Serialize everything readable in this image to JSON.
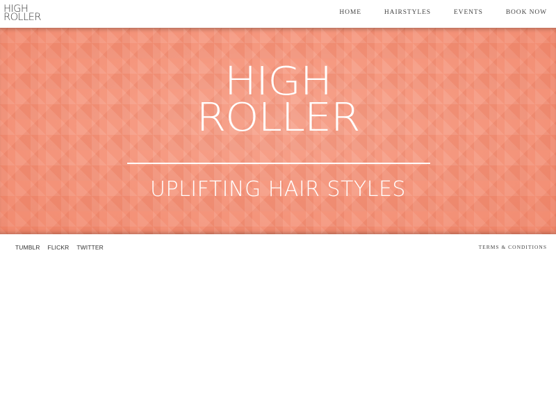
{
  "brand": {
    "logo_line1": "HIGH",
    "logo_line2": "ROLLER"
  },
  "nav": {
    "items": [
      {
        "label": "HOME"
      },
      {
        "label": "HAIRSTYLES"
      },
      {
        "label": "EVENTS"
      },
      {
        "label": "BOOK NOW"
      }
    ]
  },
  "hero": {
    "title_line1": "HIGH",
    "title_line2": "ROLLER",
    "tagline": "UPLIFTING HAIR STYLES",
    "background_color": "#f48c70"
  },
  "footer": {
    "social": [
      {
        "label": "TUMBLR"
      },
      {
        "label": "FLICKR"
      },
      {
        "label": "TWITTER"
      }
    ],
    "terms_label": "TERMS & CONDITIONS"
  }
}
